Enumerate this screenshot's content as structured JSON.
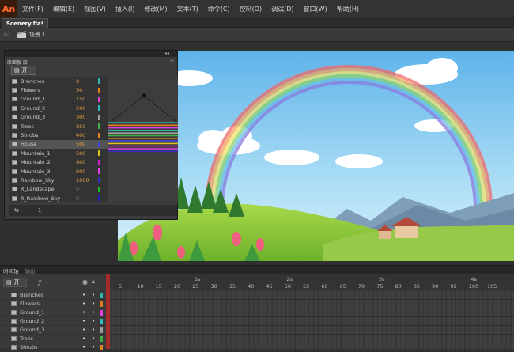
{
  "app": {
    "logo": "An"
  },
  "menu": [
    "文件(F)",
    "编辑(E)",
    "视图(V)",
    "插入(I)",
    "修改(M)",
    "文本(T)",
    "命令(C)",
    "控制(O)",
    "调试(D)",
    "窗口(W)",
    "帮助(H)"
  ],
  "document": {
    "tab": "Scenery.fla*"
  },
  "scene": {
    "label": "场景 1"
  },
  "library": {
    "tab": "库面板 库",
    "open_label": "开",
    "footer_count": "1",
    "rows": [
      {
        "name": "Branches",
        "value": "0",
        "color": "#2fb5b5"
      },
      {
        "name": "Flowers",
        "value": "50",
        "color": "#e07b20"
      },
      {
        "name": "Ground_1",
        "value": "150",
        "color": "#e040e0"
      },
      {
        "name": "Ground_2",
        "value": "200",
        "color": "#30c0c0"
      },
      {
        "name": "Ground_3",
        "value": "300",
        "color": "#a0a0a0"
      },
      {
        "name": "Trees",
        "value": "350",
        "color": "#40b040"
      },
      {
        "name": "Shrubs",
        "value": "400",
        "color": "#e08020"
      },
      {
        "name": "House",
        "value": "500",
        "color": "#4040e0"
      },
      {
        "name": "Mountain_1",
        "value": "500",
        "color": "#e0c020"
      },
      {
        "name": "Mountain_2",
        "value": "800",
        "color": "#d020d0"
      },
      {
        "name": "Mountain_3",
        "value": "900",
        "color": "#e040e0"
      },
      {
        "name": "Rainbow_Sky",
        "value": "1000",
        "color": "#3030c0"
      },
      {
        "name": "R_Landscape",
        "value": "0",
        "color": "#20c020"
      },
      {
        "name": "R_Rainbow_Sky",
        "value": "0",
        "color": "#2020c0"
      }
    ]
  },
  "timeline": {
    "tabs": [
      "时间轴",
      "输出"
    ],
    "open_label": "开",
    "frame_numbers": [
      "5",
      "10",
      "15",
      "20",
      "25",
      "30",
      "35",
      "40",
      "45",
      "50",
      "55",
      "60",
      "65",
      "70",
      "75",
      "80",
      "85",
      "90",
      "95",
      "100",
      "105"
    ],
    "seconds": [
      "1s",
      "2s",
      "3s",
      "4s"
    ],
    "layers": [
      {
        "name": "Branches",
        "color": "#2fb5b5"
      },
      {
        "name": "Flowers",
        "color": "#e07b20"
      },
      {
        "name": "Ground_1",
        "color": "#e040e0"
      },
      {
        "name": "Ground_2",
        "color": "#30c0c0"
      },
      {
        "name": "Ground_3",
        "color": "#a0a0a0"
      },
      {
        "name": "Trees",
        "color": "#40b040"
      },
      {
        "name": "Shrubs",
        "color": "#e08020"
      }
    ]
  }
}
